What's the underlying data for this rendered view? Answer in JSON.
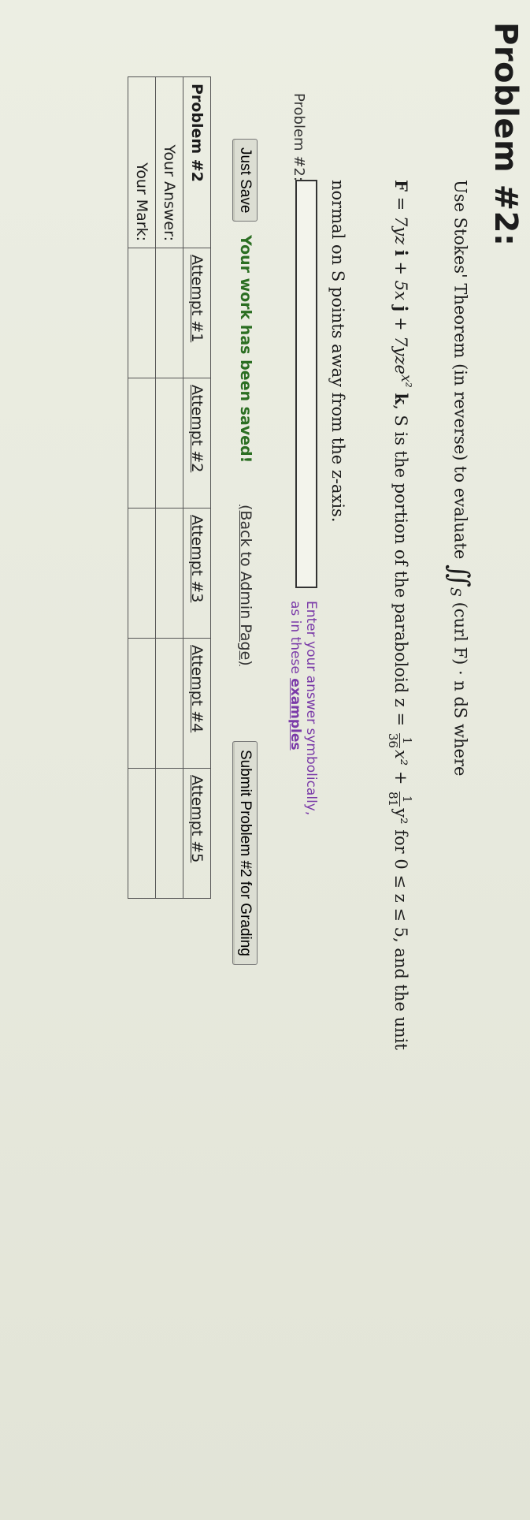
{
  "problem": {
    "title": "Problem #2:",
    "intro": "Use Stokes' Theorem (in reverse) to evaluate",
    "integral_sub": "S",
    "integrand": "(curl F) · n dS",
    "where": "where",
    "field_F": "F",
    "field_eq": " = 7yz ",
    "i": "i",
    "plus_5x": " + 5x ",
    "j": "j",
    "plus_7yze": " + 7yze",
    "exp": "x²",
    "k": "k",
    "s_desc": ", S is the portion of the paraboloid z = ",
    "frac1_num": "1",
    "frac1_den": "36",
    "x2_plus": "x² + ",
    "frac2_num": "1",
    "frac2_den": "81",
    "y2_for": "y²  for 0 ≤ z ≤ 5,  and the unit",
    "line3": "normal on S points away from the z-axis."
  },
  "answer": {
    "label": "Problem #2:",
    "value": "",
    "hint_line1": "Enter your answer symbolically,",
    "hint_line2": "as in these ",
    "hint_link": "examples"
  },
  "actions": {
    "just_save": "Just Save",
    "saved_message": "Your work has been saved!",
    "admin_link": "(Back to Admin Page)",
    "submit": "Submit Problem #2 for Grading"
  },
  "attempts_table": {
    "header_label": "Problem #2",
    "row_answer": "Your Answer:",
    "row_mark": "Your Mark:",
    "attempts": [
      "Attempt #1",
      "Attempt #2",
      "Attempt #3",
      "Attempt #4",
      "Attempt #5"
    ]
  }
}
